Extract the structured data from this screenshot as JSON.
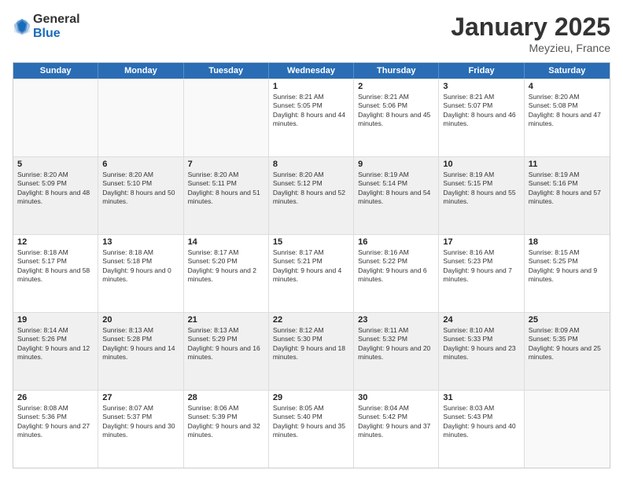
{
  "logo": {
    "general": "General",
    "blue": "Blue"
  },
  "title": "January 2025",
  "subtitle": "Meyzieu, France",
  "days": [
    "Sunday",
    "Monday",
    "Tuesday",
    "Wednesday",
    "Thursday",
    "Friday",
    "Saturday"
  ],
  "weeks": [
    [
      {
        "day": "",
        "sunrise": "",
        "sunset": "",
        "daylight": "",
        "shaded": false,
        "empty": true
      },
      {
        "day": "",
        "sunrise": "",
        "sunset": "",
        "daylight": "",
        "shaded": false,
        "empty": true
      },
      {
        "day": "",
        "sunrise": "",
        "sunset": "",
        "daylight": "",
        "shaded": false,
        "empty": true
      },
      {
        "day": "1",
        "sunrise": "Sunrise: 8:21 AM",
        "sunset": "Sunset: 5:05 PM",
        "daylight": "Daylight: 8 hours and 44 minutes.",
        "shaded": false,
        "empty": false
      },
      {
        "day": "2",
        "sunrise": "Sunrise: 8:21 AM",
        "sunset": "Sunset: 5:06 PM",
        "daylight": "Daylight: 8 hours and 45 minutes.",
        "shaded": false,
        "empty": false
      },
      {
        "day": "3",
        "sunrise": "Sunrise: 8:21 AM",
        "sunset": "Sunset: 5:07 PM",
        "daylight": "Daylight: 8 hours and 46 minutes.",
        "shaded": false,
        "empty": false
      },
      {
        "day": "4",
        "sunrise": "Sunrise: 8:20 AM",
        "sunset": "Sunset: 5:08 PM",
        "daylight": "Daylight: 8 hours and 47 minutes.",
        "shaded": false,
        "empty": false
      }
    ],
    [
      {
        "day": "5",
        "sunrise": "Sunrise: 8:20 AM",
        "sunset": "Sunset: 5:09 PM",
        "daylight": "Daylight: 8 hours and 48 minutes.",
        "shaded": true,
        "empty": false
      },
      {
        "day": "6",
        "sunrise": "Sunrise: 8:20 AM",
        "sunset": "Sunset: 5:10 PM",
        "daylight": "Daylight: 8 hours and 50 minutes.",
        "shaded": true,
        "empty": false
      },
      {
        "day": "7",
        "sunrise": "Sunrise: 8:20 AM",
        "sunset": "Sunset: 5:11 PM",
        "daylight": "Daylight: 8 hours and 51 minutes.",
        "shaded": true,
        "empty": false
      },
      {
        "day": "8",
        "sunrise": "Sunrise: 8:20 AM",
        "sunset": "Sunset: 5:12 PM",
        "daylight": "Daylight: 8 hours and 52 minutes.",
        "shaded": true,
        "empty": false
      },
      {
        "day": "9",
        "sunrise": "Sunrise: 8:19 AM",
        "sunset": "Sunset: 5:14 PM",
        "daylight": "Daylight: 8 hours and 54 minutes.",
        "shaded": true,
        "empty": false
      },
      {
        "day": "10",
        "sunrise": "Sunrise: 8:19 AM",
        "sunset": "Sunset: 5:15 PM",
        "daylight": "Daylight: 8 hours and 55 minutes.",
        "shaded": true,
        "empty": false
      },
      {
        "day": "11",
        "sunrise": "Sunrise: 8:19 AM",
        "sunset": "Sunset: 5:16 PM",
        "daylight": "Daylight: 8 hours and 57 minutes.",
        "shaded": true,
        "empty": false
      }
    ],
    [
      {
        "day": "12",
        "sunrise": "Sunrise: 8:18 AM",
        "sunset": "Sunset: 5:17 PM",
        "daylight": "Daylight: 8 hours and 58 minutes.",
        "shaded": false,
        "empty": false
      },
      {
        "day": "13",
        "sunrise": "Sunrise: 8:18 AM",
        "sunset": "Sunset: 5:18 PM",
        "daylight": "Daylight: 9 hours and 0 minutes.",
        "shaded": false,
        "empty": false
      },
      {
        "day": "14",
        "sunrise": "Sunrise: 8:17 AM",
        "sunset": "Sunset: 5:20 PM",
        "daylight": "Daylight: 9 hours and 2 minutes.",
        "shaded": false,
        "empty": false
      },
      {
        "day": "15",
        "sunrise": "Sunrise: 8:17 AM",
        "sunset": "Sunset: 5:21 PM",
        "daylight": "Daylight: 9 hours and 4 minutes.",
        "shaded": false,
        "empty": false
      },
      {
        "day": "16",
        "sunrise": "Sunrise: 8:16 AM",
        "sunset": "Sunset: 5:22 PM",
        "daylight": "Daylight: 9 hours and 6 minutes.",
        "shaded": false,
        "empty": false
      },
      {
        "day": "17",
        "sunrise": "Sunrise: 8:16 AM",
        "sunset": "Sunset: 5:23 PM",
        "daylight": "Daylight: 9 hours and 7 minutes.",
        "shaded": false,
        "empty": false
      },
      {
        "day": "18",
        "sunrise": "Sunrise: 8:15 AM",
        "sunset": "Sunset: 5:25 PM",
        "daylight": "Daylight: 9 hours and 9 minutes.",
        "shaded": false,
        "empty": false
      }
    ],
    [
      {
        "day": "19",
        "sunrise": "Sunrise: 8:14 AM",
        "sunset": "Sunset: 5:26 PM",
        "daylight": "Daylight: 9 hours and 12 minutes.",
        "shaded": true,
        "empty": false
      },
      {
        "day": "20",
        "sunrise": "Sunrise: 8:13 AM",
        "sunset": "Sunset: 5:28 PM",
        "daylight": "Daylight: 9 hours and 14 minutes.",
        "shaded": true,
        "empty": false
      },
      {
        "day": "21",
        "sunrise": "Sunrise: 8:13 AM",
        "sunset": "Sunset: 5:29 PM",
        "daylight": "Daylight: 9 hours and 16 minutes.",
        "shaded": true,
        "empty": false
      },
      {
        "day": "22",
        "sunrise": "Sunrise: 8:12 AM",
        "sunset": "Sunset: 5:30 PM",
        "daylight": "Daylight: 9 hours and 18 minutes.",
        "shaded": true,
        "empty": false
      },
      {
        "day": "23",
        "sunrise": "Sunrise: 8:11 AM",
        "sunset": "Sunset: 5:32 PM",
        "daylight": "Daylight: 9 hours and 20 minutes.",
        "shaded": true,
        "empty": false
      },
      {
        "day": "24",
        "sunrise": "Sunrise: 8:10 AM",
        "sunset": "Sunset: 5:33 PM",
        "daylight": "Daylight: 9 hours and 23 minutes.",
        "shaded": true,
        "empty": false
      },
      {
        "day": "25",
        "sunrise": "Sunrise: 8:09 AM",
        "sunset": "Sunset: 5:35 PM",
        "daylight": "Daylight: 9 hours and 25 minutes.",
        "shaded": true,
        "empty": false
      }
    ],
    [
      {
        "day": "26",
        "sunrise": "Sunrise: 8:08 AM",
        "sunset": "Sunset: 5:36 PM",
        "daylight": "Daylight: 9 hours and 27 minutes.",
        "shaded": false,
        "empty": false
      },
      {
        "day": "27",
        "sunrise": "Sunrise: 8:07 AM",
        "sunset": "Sunset: 5:37 PM",
        "daylight": "Daylight: 9 hours and 30 minutes.",
        "shaded": false,
        "empty": false
      },
      {
        "day": "28",
        "sunrise": "Sunrise: 8:06 AM",
        "sunset": "Sunset: 5:39 PM",
        "daylight": "Daylight: 9 hours and 32 minutes.",
        "shaded": false,
        "empty": false
      },
      {
        "day": "29",
        "sunrise": "Sunrise: 8:05 AM",
        "sunset": "Sunset: 5:40 PM",
        "daylight": "Daylight: 9 hours and 35 minutes.",
        "shaded": false,
        "empty": false
      },
      {
        "day": "30",
        "sunrise": "Sunrise: 8:04 AM",
        "sunset": "Sunset: 5:42 PM",
        "daylight": "Daylight: 9 hours and 37 minutes.",
        "shaded": false,
        "empty": false
      },
      {
        "day": "31",
        "sunrise": "Sunrise: 8:03 AM",
        "sunset": "Sunset: 5:43 PM",
        "daylight": "Daylight: 9 hours and 40 minutes.",
        "shaded": false,
        "empty": false
      },
      {
        "day": "",
        "sunrise": "",
        "sunset": "",
        "daylight": "",
        "shaded": false,
        "empty": true
      }
    ]
  ]
}
